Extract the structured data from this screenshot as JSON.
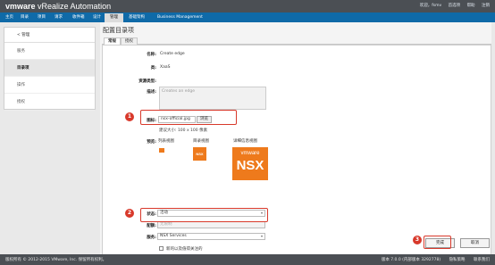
{
  "header": {
    "logo_brand": "vmware",
    "logo_product": " vRealize  Automation",
    "user_links": [
      "欢迎，fsmv",
      "首选项",
      "帮助",
      "注销"
    ]
  },
  "nav": {
    "items": [
      "主页",
      "目录",
      "项目",
      "请求",
      "收件箱",
      "设计",
      "管理",
      "基础架构",
      "Business Management"
    ],
    "active": "管理"
  },
  "sidebar": {
    "back_label": "< 管理",
    "items": [
      "服务",
      "目录项",
      "操作",
      "授权"
    ],
    "selected": "目录项"
  },
  "main": {
    "page_title": "配置目录项",
    "tabs": [
      "常规",
      "授权"
    ],
    "form": {
      "name_label": "名称:",
      "name_value": "Create edge",
      "type_label": "类:",
      "type_value": "XaaS",
      "resource_type_label": "资源类型:",
      "description_label": "描述:",
      "description_placeholder": "Creates an edge",
      "icon_label": "图标:",
      "icon_file": "nsx-official.jpg",
      "browse_label": "浏览",
      "icon_hint": "建议大小: 100 x 100 像素",
      "preview_label": "预览:",
      "preview_list": "列表视图",
      "preview_catalog": "目录视图",
      "preview_detail": "详细信息视图",
      "status_label": "状态:",
      "status_value": "活动",
      "quota_label": "配额:",
      "quota_placeholder": "无限制",
      "service_label": "服务:",
      "service_value": "NSX Services",
      "new_and_noteworthy_label": "新的以及值得关注的"
    },
    "finish_label": "完成",
    "cancel_label": "取消"
  },
  "callouts": [
    "1",
    "2",
    "3"
  ],
  "nsx_tile": {
    "vmware": "vmware",
    "nsx": "NSX"
  },
  "footer": {
    "copyright": "版权所有 © 2012-2015 VMware, Inc. 保留所有权利。",
    "version": "版本 7.0.0 (内部版本 3292778)",
    "privacy": "隐私策略",
    "contact": "联系我们"
  },
  "colors": {
    "nav_blue": "#0f6aa8",
    "top_gray": "#4b4f54",
    "callout_red": "#d8392b",
    "nsx_orange": "#ee7a1c"
  }
}
